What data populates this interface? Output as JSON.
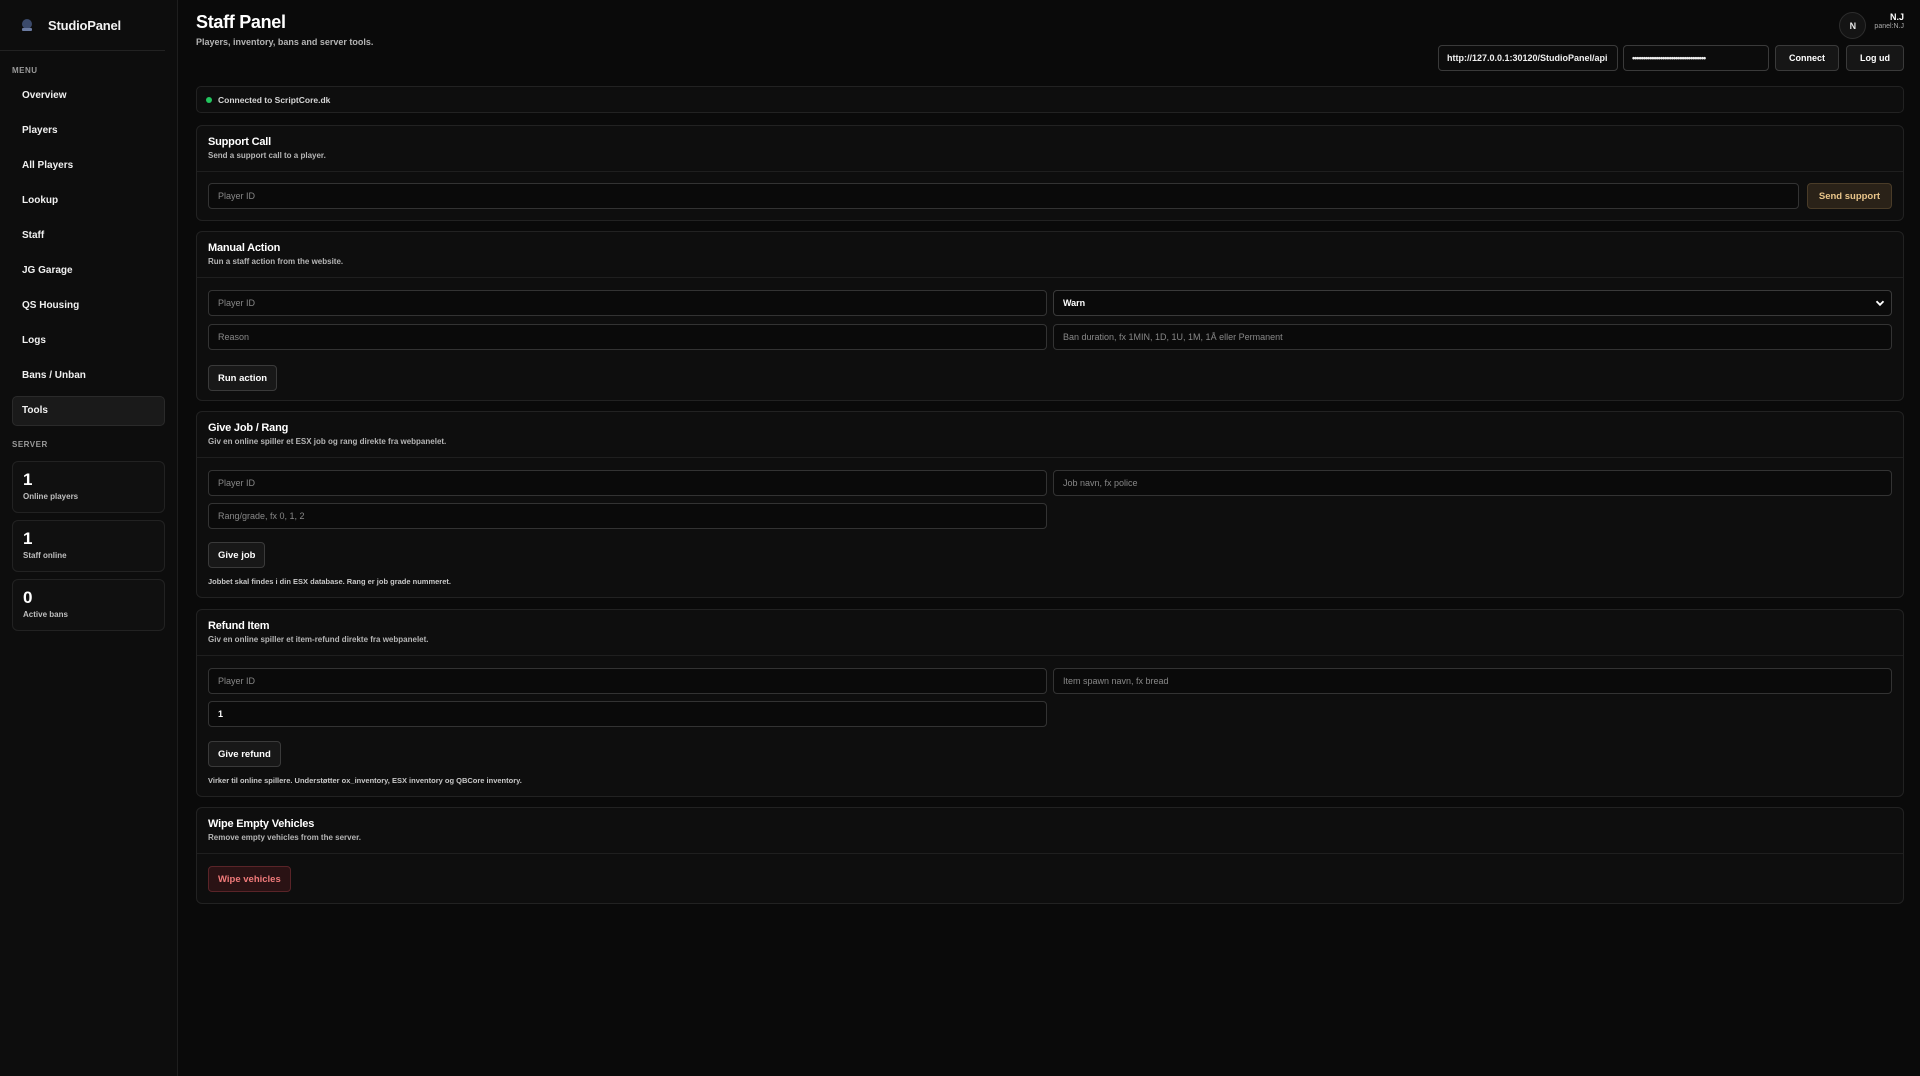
{
  "brand": {
    "name": "StudioPanel",
    "logo_icon": "studio-logo-icon"
  },
  "sidebar": {
    "menu_label": "MENU",
    "items": [
      {
        "label": "Overview"
      },
      {
        "label": "Players"
      },
      {
        "label": "All Players"
      },
      {
        "label": "Lookup"
      },
      {
        "label": "Staff"
      },
      {
        "label": "JG Garage"
      },
      {
        "label": "QS Housing"
      },
      {
        "label": "Logs"
      },
      {
        "label": "Bans / Unban"
      },
      {
        "label": "Tools",
        "active": true
      }
    ],
    "server_label": "SERVER",
    "stats": [
      {
        "value": "1",
        "label": "Online players"
      },
      {
        "value": "1",
        "label": "Staff online"
      },
      {
        "value": "0",
        "label": "Active bans"
      }
    ]
  },
  "header": {
    "title": "Staff Panel",
    "subtitle": "Players, inventory, bans and server tools.",
    "user": {
      "initial": "N",
      "name": "N.J",
      "role": "panel:N.J"
    },
    "api_url": "http://127.0.0.1:30120/StudioPanel/api",
    "api_key_masked": "••••••••••••••••••••••••••••••••••",
    "connect_label": "Connect",
    "logout_label": "Log ud"
  },
  "status": {
    "text": "Connected to ScriptCore.dk",
    "color": "#22c55e"
  },
  "support": {
    "title": "Support Call",
    "subtitle": "Send a support call to a player.",
    "player_placeholder": "Player ID",
    "button": "Send support"
  },
  "manual": {
    "title": "Manual Action",
    "subtitle": "Run a staff action from the website.",
    "player_placeholder": "Player ID",
    "action_selected": "Warn",
    "reason_placeholder": "Reason",
    "duration_placeholder": "Ban duration, fx 1MIN, 1D, 1U, 1M, 1Å eller Permanent",
    "button": "Run action"
  },
  "job": {
    "title": "Give Job / Rang",
    "subtitle": "Giv en online spiller et ESX job og rang direkte fra webpanelet.",
    "player_placeholder": "Player ID",
    "job_placeholder": "Job navn, fx police",
    "grade_placeholder": "Rang/grade, fx 0, 1, 2",
    "button": "Give job",
    "note": "Jobbet skal findes i din ESX database. Rang er job grade nummeret."
  },
  "refund": {
    "title": "Refund Item",
    "subtitle": "Giv en online spiller et item-refund direkte fra webpanelet.",
    "player_placeholder": "Player ID",
    "item_placeholder": "Item spawn navn, fx bread",
    "amount_value": "1",
    "button": "Give refund",
    "note": "Virker til online spillere. Understøtter ox_inventory, ESX inventory og QBCore inventory."
  },
  "wipe": {
    "title": "Wipe Empty Vehicles",
    "subtitle": "Remove empty vehicles from the server.",
    "button": "Wipe vehicles"
  }
}
